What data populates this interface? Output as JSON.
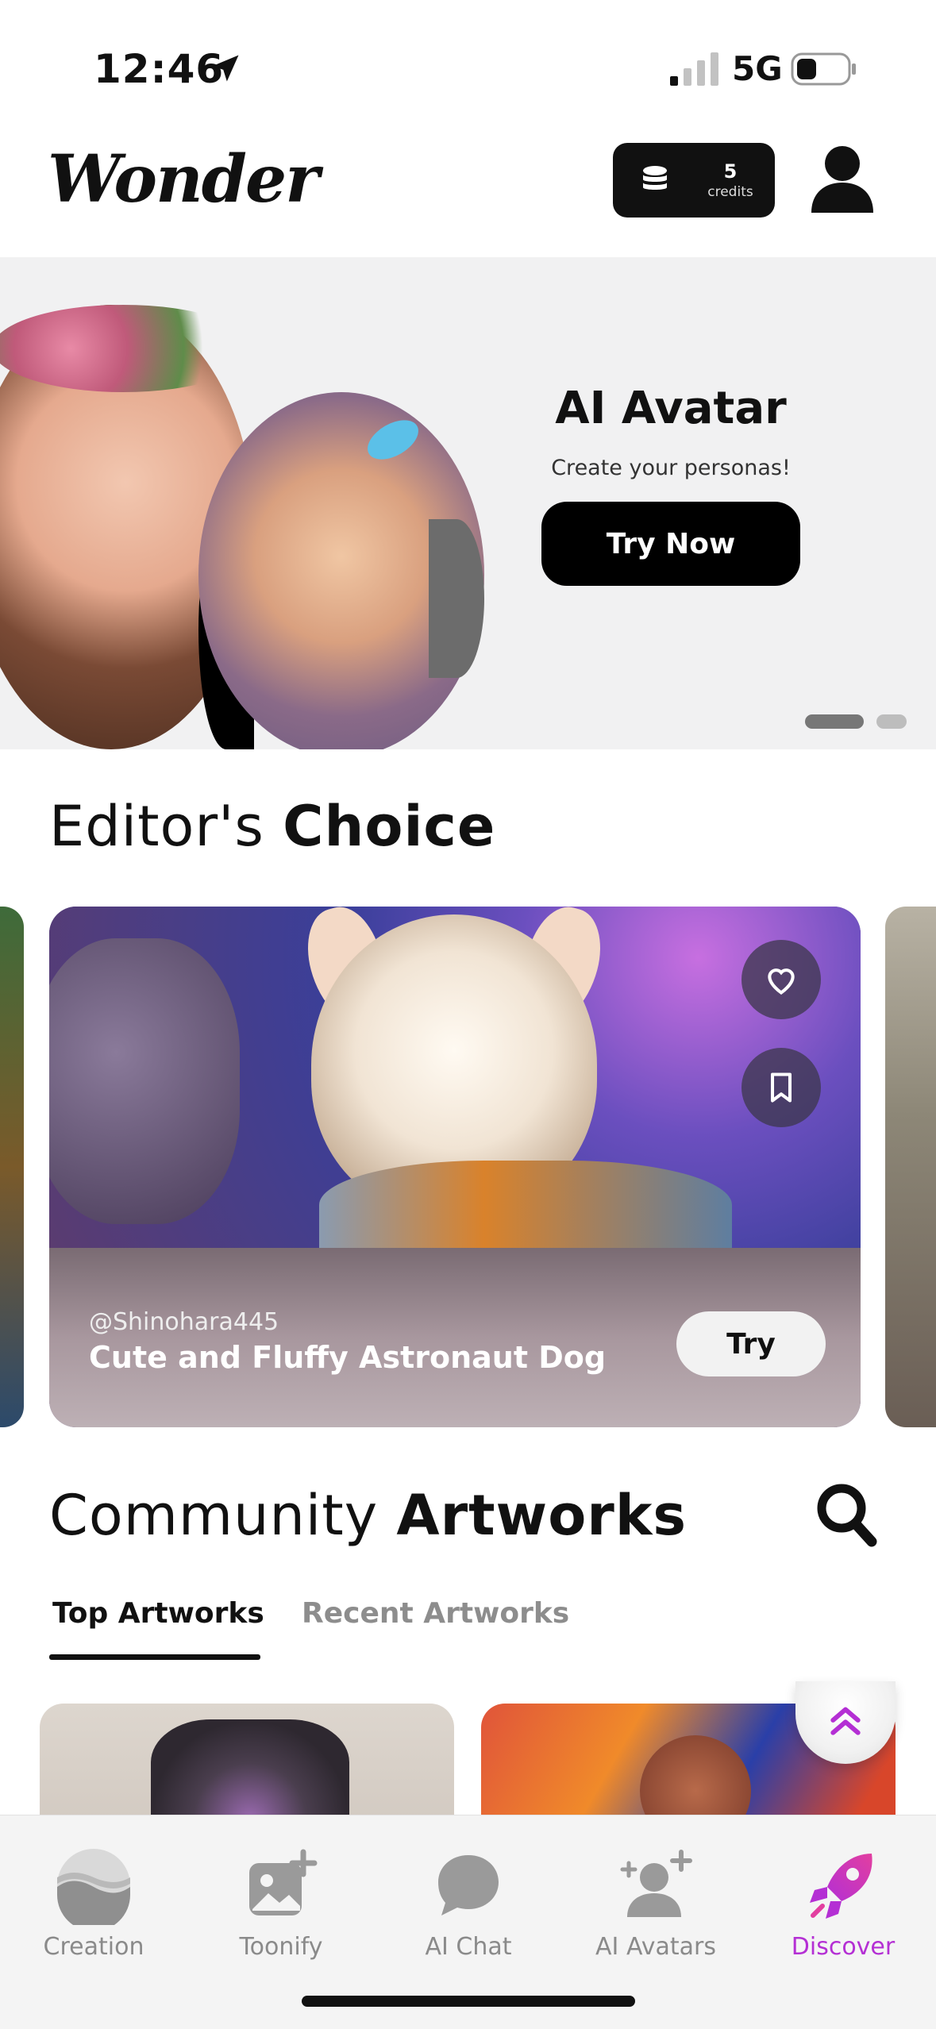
{
  "status_bar": {
    "time": "12:46",
    "network": "5G"
  },
  "header": {
    "logo": "Wonder",
    "credits_count": "5",
    "credits_label": "credits"
  },
  "banner": {
    "title": "AI Avatar",
    "subtitle": "Create your personas!",
    "cta": "Try Now",
    "page_count": 2,
    "active_page": 1
  },
  "editors_choice": {
    "title_light": "Editor's ",
    "title_bold": "Choice",
    "card": {
      "handle": "@Shinohara445",
      "title": "Cute and Fluffy Astronaut Dog",
      "try_label": "Try"
    }
  },
  "community": {
    "title_light": "Community ",
    "title_bold": "Artworks",
    "tabs": [
      {
        "label": "Top Artworks",
        "active": true
      },
      {
        "label": "Recent Artworks",
        "active": false
      }
    ]
  },
  "tab_bar": {
    "items": [
      {
        "label": "Creation",
        "icon": "creation-icon"
      },
      {
        "label": "Toonify",
        "icon": "image-add-icon"
      },
      {
        "label": "AI Chat",
        "icon": "chat-bubble-icon"
      },
      {
        "label": "AI Avatars",
        "icon": "avatar-add-icon"
      },
      {
        "label": "Discover",
        "icon": "rocket-icon",
        "active": true
      }
    ]
  },
  "colors": {
    "accent": "#b42fd4",
    "dark": "#111111",
    "inactive": "#8a8a8a"
  }
}
